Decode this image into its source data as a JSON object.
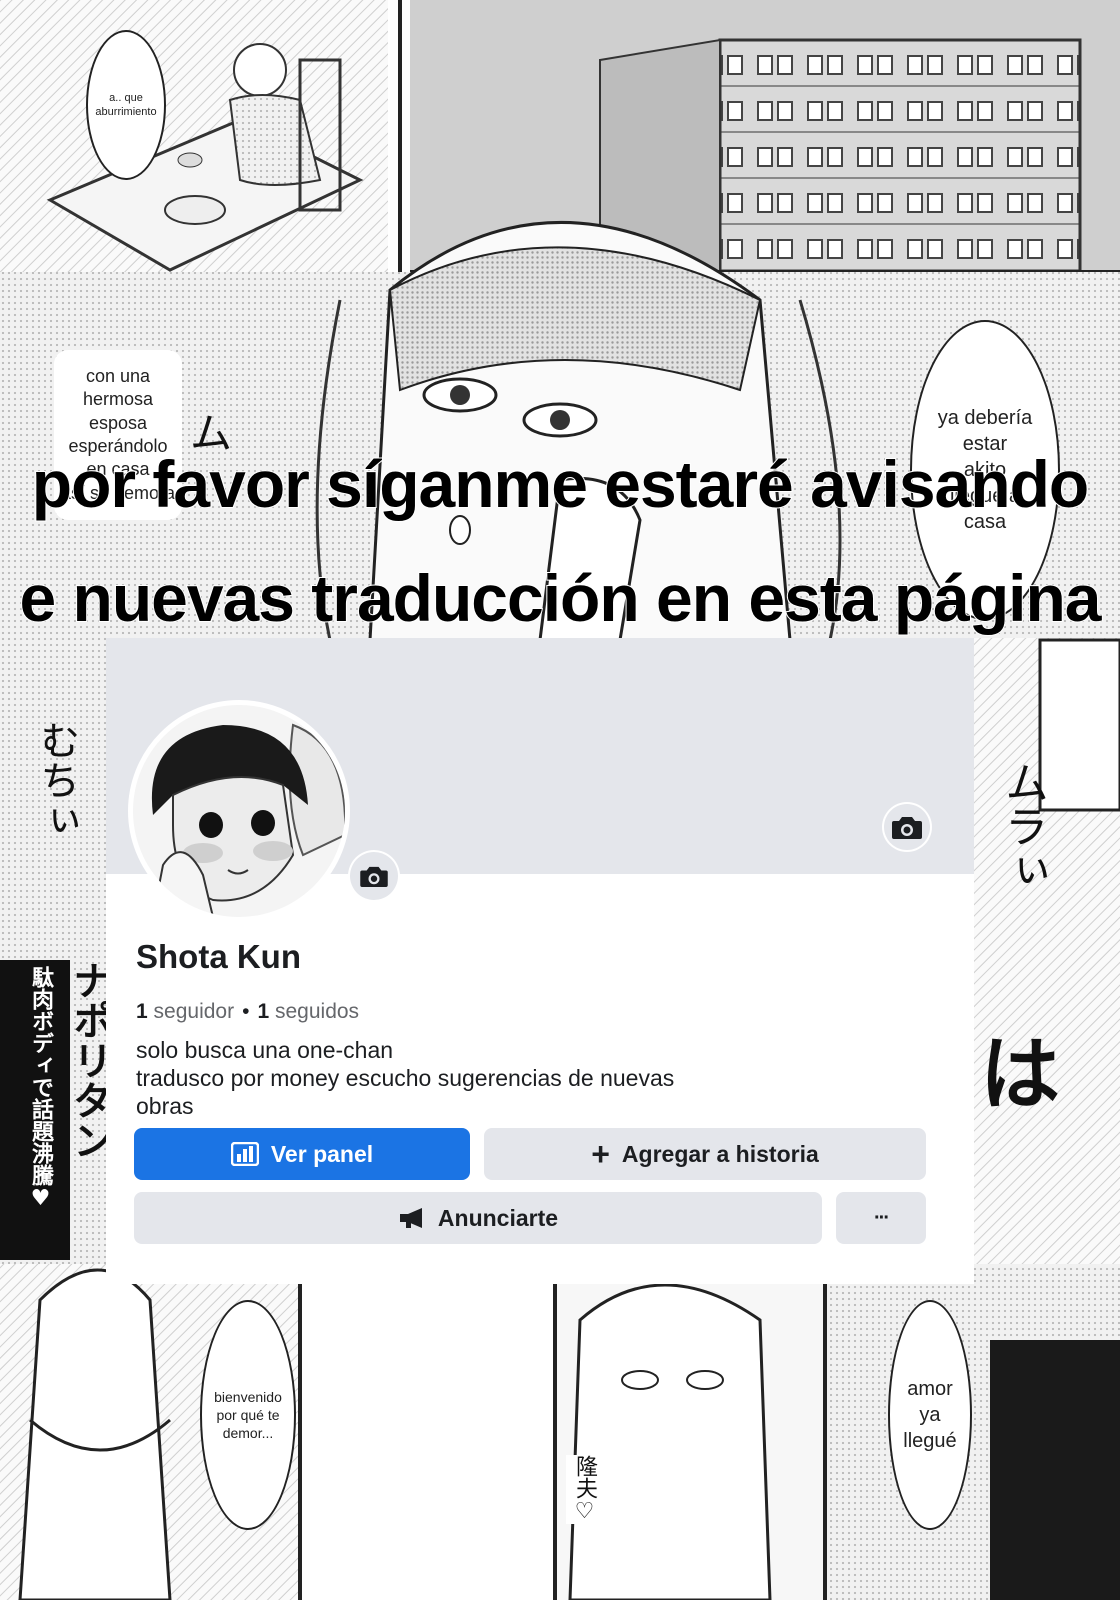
{
  "bubbles": [
    {
      "lines": [
        "a.. que",
        "aburrimiento"
      ]
    },
    {
      "lines": [
        "con una",
        "hermosa",
        "esposa",
        "esperándolo",
        "en casa",
        "así se demora"
      ]
    },
    {
      "lines": [
        "ya debería",
        "estar",
        "akito",
        "llegue a",
        "casa"
      ]
    },
    {
      "lines": [
        "bienvenido",
        "por qué te",
        "demor..."
      ]
    },
    {
      "lines": [
        "amor",
        "ya",
        "llegué"
      ]
    }
  ],
  "sfx": {
    "left_vertical": "むちぃ",
    "right_vertical": "ムラぃ",
    "left_katakana": "ム",
    "cover_title": "ナポリタン",
    "cover_tagline": "駄肉ボディで話題沸騰♥",
    "name_tag": "隆夫♡",
    "right_big": "は"
  },
  "banner": {
    "line1": "por favor síganme estaré avisando",
    "line2": "e nuevas traducción en esta página"
  },
  "profile": {
    "name": "Shota Kun",
    "followers_count": "1",
    "followers_label": "seguidor",
    "separator": "•",
    "following_count": "1",
    "following_label": "seguidos",
    "bio_lines": [
      "solo busca una one-chan",
      "tradusco por money escucho sugerencias de nuevas",
      "obras"
    ],
    "buttons": {
      "dashboard": "Ver panel",
      "add_story": "Agregar a historia",
      "advertise": "Anunciarte",
      "more": "···"
    }
  },
  "colors": {
    "facebook_blue": "#1b74e4",
    "button_gray": "#e4e6eb",
    "secondary_text": "#65676b"
  }
}
